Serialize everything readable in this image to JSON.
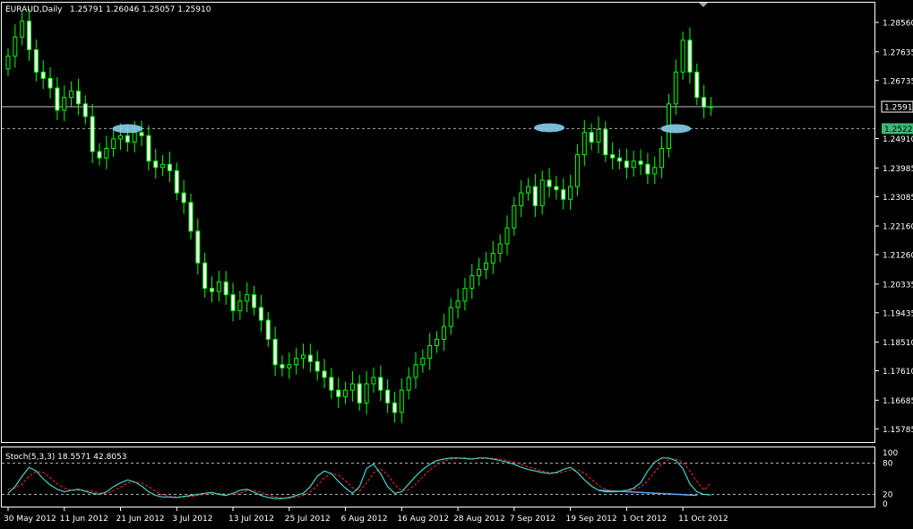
{
  "header": {
    "symbol_tf": "EURAUD,Daily",
    "ohlc": "1.25791 1.26046 1.25057 1.25910"
  },
  "sub_window": {
    "label": "Stoch(5,3,3) 18.5571 42.8053"
  },
  "colors": {
    "background": "#000000",
    "border": "#ffffff",
    "bull_body": "#000000",
    "bear_body": "#ffffff",
    "wick": "#00ff00",
    "price_line": "#c0c0c0",
    "level_line": "#aaaaaa",
    "level_box": "#3cb878",
    "ellipse": "#87ceeb",
    "stoch_main": "#48d1cc",
    "stoch_signal": "#ff2a2a",
    "divergence": "#5fa8ff"
  },
  "chart_data": [
    {
      "type": "candlestick",
      "title": "EURAUD,Daily",
      "ylim": [
        1.1537,
        1.2918
      ],
      "y_ticks": [
        "1.28560",
        "1.27635",
        "1.26735",
        "1.25910",
        "1.25222",
        "1.24910",
        "1.23985",
        "1.23085",
        "1.22160",
        "1.21260",
        "1.20335",
        "1.19435",
        "1.18510",
        "1.17610",
        "1.16685",
        "1.15785"
      ],
      "current_price": {
        "value": 1.2591,
        "label": "1.25910"
      },
      "level_line": {
        "value": 1.25222,
        "label": "1.25222"
      },
      "x_labels": [
        {
          "label": "30 May 2012",
          "index": 0
        },
        {
          "label": "11 Jun 2012",
          "index": 8
        },
        {
          "label": "21 Jun 2012",
          "index": 16
        },
        {
          "label": "3 Jul 2012",
          "index": 24
        },
        {
          "label": "13 Jul 2012",
          "index": 32
        },
        {
          "label": "25 Jul 2012",
          "index": 40
        },
        {
          "label": "6 Aug 2012",
          "index": 48
        },
        {
          "label": "16 Aug 2012",
          "index": 56
        },
        {
          "label": "28 Aug 2012",
          "index": 64
        },
        {
          "label": "7 Sep 2012",
          "index": 72
        },
        {
          "label": "19 Sep 2012",
          "index": 80
        },
        {
          "label": "1 Oct 2012",
          "index": 88
        },
        {
          "label": "11 Oct 2012",
          "index": 96
        }
      ],
      "ellipses": [
        {
          "index": 17,
          "value": 1.2522
        },
        {
          "index": 77,
          "value": 1.2525
        },
        {
          "index": 95,
          "value": 1.2522
        }
      ],
      "close": [
        1.275,
        1.281,
        1.286,
        1.277,
        1.27,
        1.268,
        1.265,
        1.258,
        1.262,
        1.264,
        1.26,
        1.256,
        1.245,
        1.243,
        1.246,
        1.249,
        1.25,
        1.248,
        1.251,
        1.25,
        1.242,
        1.24,
        1.241,
        1.239,
        1.232,
        1.229,
        1.22,
        1.21,
        1.202,
        1.201,
        1.204,
        1.2,
        1.195,
        1.198,
        1.2,
        1.196,
        1.192,
        1.186,
        1.178,
        1.177,
        1.178,
        1.18,
        1.181,
        1.179,
        1.176,
        1.174,
        1.17,
        1.168,
        1.17,
        1.172,
        1.166,
        1.172,
        1.174,
        1.17,
        1.166,
        1.163,
        1.17,
        1.174,
        1.178,
        1.18,
        1.184,
        1.186,
        1.19,
        1.196,
        1.198,
        1.202,
        1.206,
        1.208,
        1.21,
        1.213,
        1.216,
        1.221,
        1.228,
        1.232,
        1.234,
        1.228,
        1.236,
        1.234,
        1.233,
        1.23,
        1.234,
        1.244,
        1.251,
        1.248,
        1.252,
        1.244,
        1.243,
        1.242,
        1.24,
        1.242,
        1.241,
        1.238,
        1.24,
        1.246,
        1.26,
        1.27,
        1.28,
        1.27,
        1.262,
        1.259,
        1.2591
      ],
      "series": [
        {
          "name": "Stoch main",
          "ylim": [
            0,
            100
          ],
          "levels": [
            80,
            20
          ],
          "values": [
            22,
            35,
            55,
            72,
            65,
            50,
            38,
            30,
            25,
            28,
            30,
            26,
            22,
            20,
            25,
            35,
            42,
            48,
            44,
            36,
            25,
            18,
            15,
            15,
            14,
            16,
            18,
            20,
            22,
            24,
            20,
            18,
            22,
            28,
            30,
            24,
            18,
            14,
            12,
            12,
            14,
            18,
            22,
            35,
            55,
            65,
            60,
            45,
            32,
            22,
            35,
            70,
            78,
            60,
            35,
            22,
            25,
            40,
            55,
            68,
            78,
            85,
            88,
            90,
            90,
            89,
            88,
            90,
            90,
            88,
            85,
            82,
            78,
            72,
            68,
            65,
            62,
            60,
            62,
            68,
            72,
            62,
            48,
            36,
            28,
            25,
            25,
            26,
            28,
            32,
            42,
            65,
            82,
            90,
            90,
            85,
            70,
            40,
            25,
            20,
            18.5571
          ]
        },
        {
          "name": "Stoch signal",
          "values": [
            30,
            32,
            40,
            55,
            64,
            62,
            52,
            40,
            32,
            28,
            28,
            28,
            26,
            23,
            22,
            27,
            34,
            42,
            44,
            42,
            35,
            26,
            19,
            16,
            15,
            15,
            16,
            18,
            20,
            22,
            22,
            21,
            20,
            22,
            27,
            28,
            24,
            19,
            15,
            13,
            13,
            15,
            18,
            25,
            37,
            52,
            60,
            57,
            46,
            33,
            26,
            42,
            61,
            69,
            58,
            39,
            27,
            29,
            40,
            54,
            67,
            77,
            84,
            88,
            89,
            90,
            89,
            89,
            89,
            89,
            88,
            85,
            82,
            78,
            73,
            69,
            65,
            62,
            61,
            63,
            67,
            67,
            61,
            49,
            37,
            30,
            26,
            25,
            26,
            29,
            34,
            46,
            63,
            79,
            87,
            88,
            82,
            65,
            45,
            28,
            42.8053
          ]
        }
      ]
    }
  ]
}
